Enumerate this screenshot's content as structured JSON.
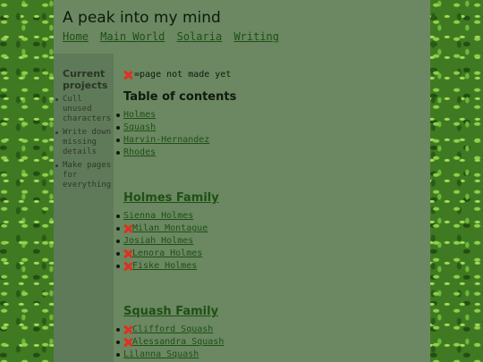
{
  "site": {
    "title": "A peak into my mind",
    "nav": [
      "Home",
      "Main World",
      "Solaria",
      "Writing"
    ]
  },
  "sidebar": {
    "heading": "Current projects",
    "items": [
      "Cull unused characters",
      "Write down missing details",
      "Make pages for everything"
    ]
  },
  "legend": {
    "icon": "red-x-icon",
    "text": "=page not made yet"
  },
  "toc": {
    "title": "Table of contents",
    "items": [
      "Holmes",
      "Squash",
      "Harvin-Hernandez",
      "Rhodes"
    ]
  },
  "sections": [
    {
      "title": "Holmes Family",
      "members": [
        {
          "name": "Sienna Holmes",
          "made": true
        },
        {
          "name": "Milan Montague",
          "made": false
        },
        {
          "name": "Josiah Holmes",
          "made": true
        },
        {
          "name": "Lenora Holmes",
          "made": false
        },
        {
          "name": "Fiske Holmes",
          "made": false
        }
      ]
    },
    {
      "title": "Squash Family",
      "members": [
        {
          "name": "Clifford Squash",
          "made": false
        },
        {
          "name": "Alessandra Squash",
          "made": false
        },
        {
          "name": "Lilanna Squash",
          "made": true
        }
      ]
    }
  ],
  "colors": {
    "page_bg": "#6b8862",
    "sidebar_bg": "#5f7a58",
    "link": "#1f4f14",
    "x_mark": "#e0301e",
    "backdrop": "#3f7a22"
  }
}
